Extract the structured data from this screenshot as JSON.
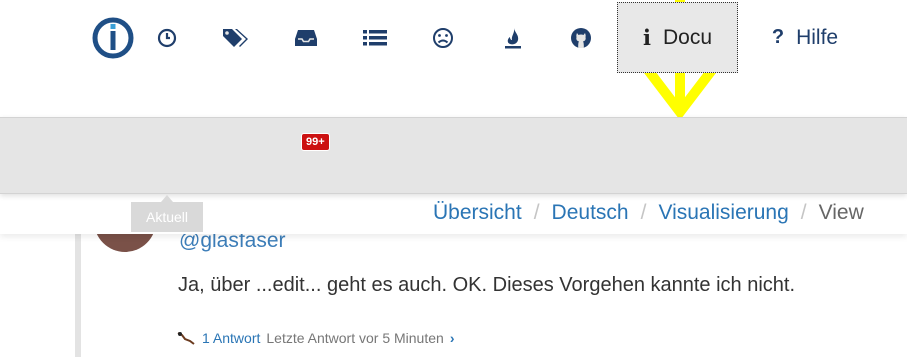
{
  "nav": {
    "logo_icon": "iobroker-logo-icon",
    "items": [
      {
        "name": "recent",
        "icon": "clock-icon"
      },
      {
        "name": "tags",
        "icon": "tags-icon"
      },
      {
        "name": "unread",
        "icon": "inbox-icon",
        "badge": "99+"
      },
      {
        "name": "categories",
        "icon": "list-icon"
      },
      {
        "name": "sad",
        "icon": "frown-icon"
      },
      {
        "name": "popular",
        "icon": "fire-icon"
      },
      {
        "name": "github",
        "icon": "github-icon"
      }
    ],
    "docu_label": "Docu",
    "hilfe_label": "Hilfe"
  },
  "tooltip": {
    "text": "Aktuell"
  },
  "breadcrumb": {
    "items": [
      "Übersicht",
      "Deutsch",
      "Visualisierung"
    ],
    "separator": "/",
    "current": "View"
  },
  "post": {
    "username": "@glasfaser",
    "content": "Ja, über ...edit... geht es auch. OK. Dieses Vorgehen kannte ich nicht.",
    "replies_link": "1 Antwort",
    "last_reply": "Letzte Antwort vor 5 Minuten"
  },
  "colors": {
    "accent": "#2a75b5",
    "nav_icon": "#1f3e6b",
    "badge": "#cc1111",
    "annotation": "#ffff00"
  }
}
